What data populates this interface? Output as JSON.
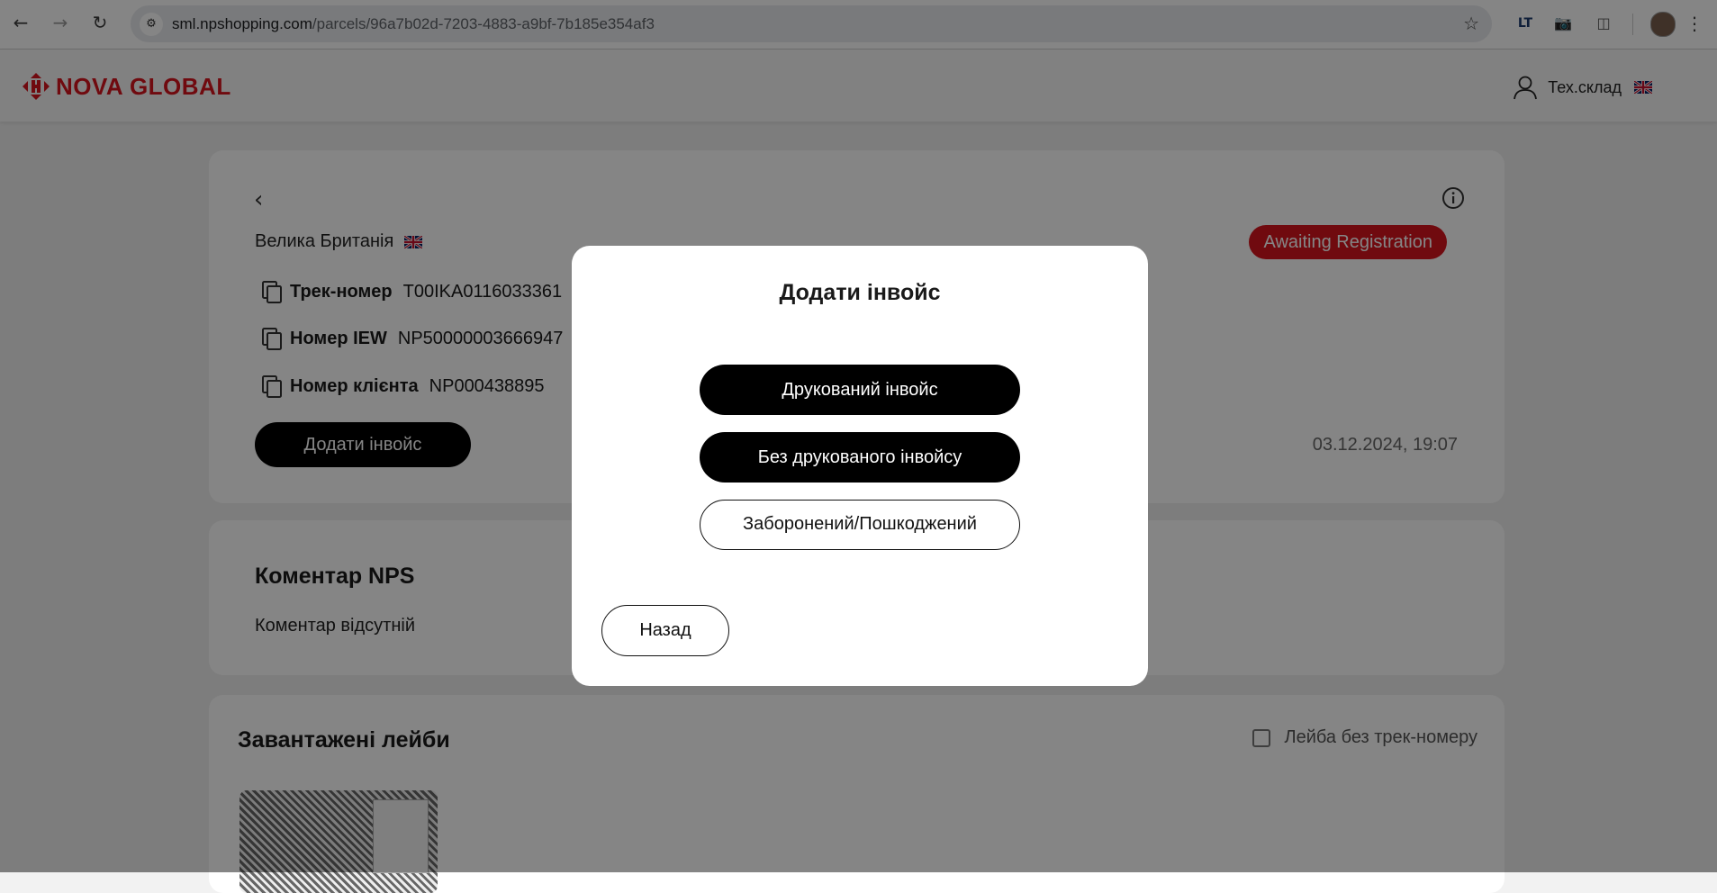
{
  "browser": {
    "url_host": "sml.npshopping.com",
    "url_path": "/parcels/96a7b02d-7203-4883-a9bf-7b185e354af3",
    "back_icon": "arrow-left-icon",
    "forward_icon": "arrow-right-icon",
    "reload_icon": "reload-icon",
    "star_icon": "star-icon",
    "extensions": [
      "lt-extension-icon",
      "camera-icon",
      "puzzle-icon"
    ],
    "ext_lt_label": "LT"
  },
  "header": {
    "logo_text": "NOVA GLOBAL",
    "brand_color": "#d7151e",
    "user_name": "Тех.склад",
    "language_flag": "uk-flag-icon"
  },
  "parcel": {
    "country": "Велика Британія",
    "status": "Awaiting Registration",
    "status_color": "#d7151e",
    "fields": [
      {
        "label": "Трек-номер",
        "value": "T00IKA0116033361"
      },
      {
        "label": "Номер IEW",
        "value": "NP50000003666947"
      },
      {
        "label": "Номер клієнта",
        "value": "NP000438895"
      }
    ],
    "add_invoice_label": "Додати інвойс",
    "date": "03.12.2024, 19:07"
  },
  "comment": {
    "title": "Коментар NPS",
    "text": "Коментар відсутній"
  },
  "labels_section": {
    "title": "Завантажені лейби",
    "checkbox_label": "Лейба без трек-номеру",
    "checkbox_checked": false
  },
  "modal": {
    "title": "Додати інвойс",
    "printed_invoice": "Друкований інвойс",
    "no_printed_invoice": "Без друкованого інвойсу",
    "forbidden_damaged": "Заборонений/Пошкоджений",
    "back": "Назад"
  }
}
